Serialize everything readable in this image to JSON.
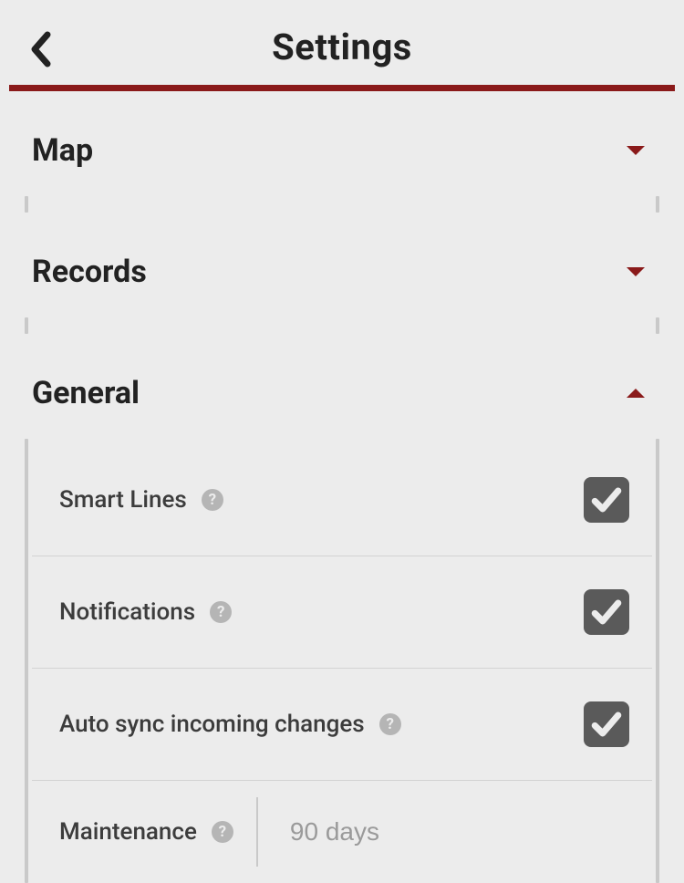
{
  "header": {
    "title": "Settings"
  },
  "sections": {
    "map": {
      "title": "Map",
      "expanded": false
    },
    "records": {
      "title": "Records",
      "expanded": false
    },
    "general": {
      "title": "General",
      "expanded": true
    }
  },
  "general_items": {
    "smart_lines": {
      "label": "Smart Lines",
      "checked": true
    },
    "notifications": {
      "label": "Notifications",
      "checked": true
    },
    "auto_sync": {
      "label": "Auto sync incoming changes",
      "checked": true
    },
    "maintenance": {
      "label": "Maintenance",
      "value": "90 days"
    }
  },
  "colors": {
    "accent": "#8a1a1a",
    "checkbox_bg": "#5a5a5a"
  }
}
